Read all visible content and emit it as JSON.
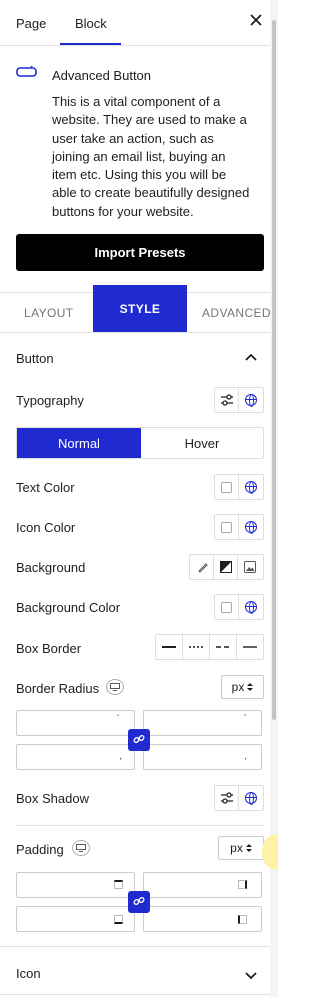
{
  "header": {
    "tabs": [
      {
        "label": "Page"
      },
      {
        "label": "Block"
      }
    ],
    "active_tab": "Block",
    "close_icon": "close-icon"
  },
  "block_card": {
    "icon": "button-icon",
    "title": "Advanced Button",
    "description": "This is a vital component of a website. They are used to make a user take an action, such as joining an email list, buying an item etc. Using this you will be able to create beautifully designed buttons for your website.",
    "import_label": "Import Presets"
  },
  "settings_tabs": {
    "layout": "LAYOUT",
    "style": "STYLE",
    "advanced": "ADVANCED",
    "active": "STYLE"
  },
  "button_panel": {
    "title": "Button",
    "typography_label": "Typography",
    "state_tabs": {
      "normal": "Normal",
      "hover": "Hover",
      "active": "Normal"
    },
    "text_color_label": "Text Color",
    "icon_color_label": "Icon Color",
    "background_label": "Background",
    "background_color_label": "Background Color",
    "box_border_label": "Box Border",
    "border_radius_label": "Border Radius",
    "border_radius_unit": "px",
    "box_shadow_label": "Box Shadow",
    "padding_label": "Padding",
    "padding_unit": "px"
  },
  "icon_panel": {
    "title": "Icon"
  },
  "colors": {
    "accent": "#1f2bd1",
    "import_bg": "#000000"
  }
}
